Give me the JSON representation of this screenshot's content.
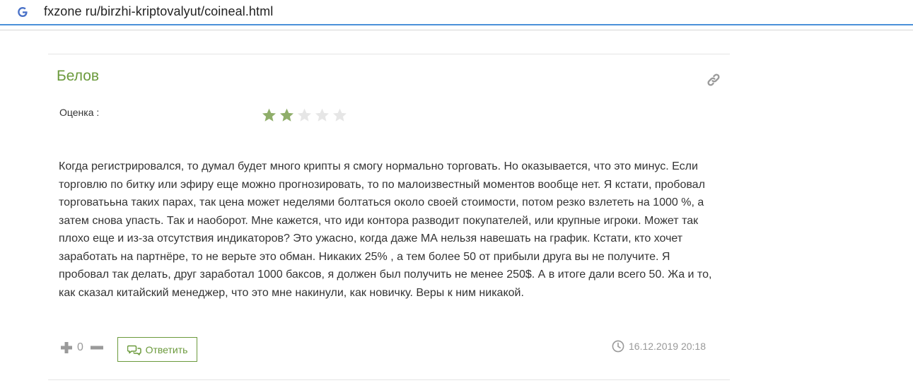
{
  "browser": {
    "url": "fxzone ru/birzhi-kriptovalyut/coineal.html"
  },
  "comment": {
    "author": "Белов",
    "rating_label": "Оценка :",
    "rating": {
      "value": 2,
      "max": 5
    },
    "text": "Когда регистрировался, то думал будет много крипты я смогу нормально торговать. Но оказывается, что это минус. Если торговлю по битку или эфиру еще можно прогнозировать, то по малоизвестный моментов вообще нет. Я кстати, пробовал торговатььна таких парах, так цена может неделями болтаться около своей стоимости, потом резко взлететь на 1000 %, а затем снова упасть. Так и наоборот. Мне кажется, что иди контора разводит покупателей, или крупные игроки. Может так плохо еще и из-за отсутствия индикаторов? Это ужасно, когда даже МА нельзя навешать на график. Кстати, кто хочет заработать на партнёре, то не верьте это обман. Никаких 25% , а тем более 50 от прибыли друга вы не получите. Я пробовал так делать, друг заработал 1000 баксов, я должен был получить не менее 250$. А в итоге дали всего 50. Жа и то, как сказал китайский менеджер, что это мне накинули, как новичку. Веры к ним никакой.",
    "votes": "0",
    "reply_label": "Ответить",
    "timestamp": "16.12.2019 20:18"
  },
  "colors": {
    "accent_green": "#6b9a3c",
    "star_filled": "#8fae6a",
    "star_empty": "#e6e6e6",
    "muted": "#999999",
    "address_border": "#4a90d9"
  },
  "icons": {
    "browser": "google-g-icon",
    "permalink": "link-icon",
    "vote_up": "plus-icon",
    "vote_down": "minus-icon",
    "reply": "chat-bubbles-icon",
    "time": "clock-icon"
  }
}
